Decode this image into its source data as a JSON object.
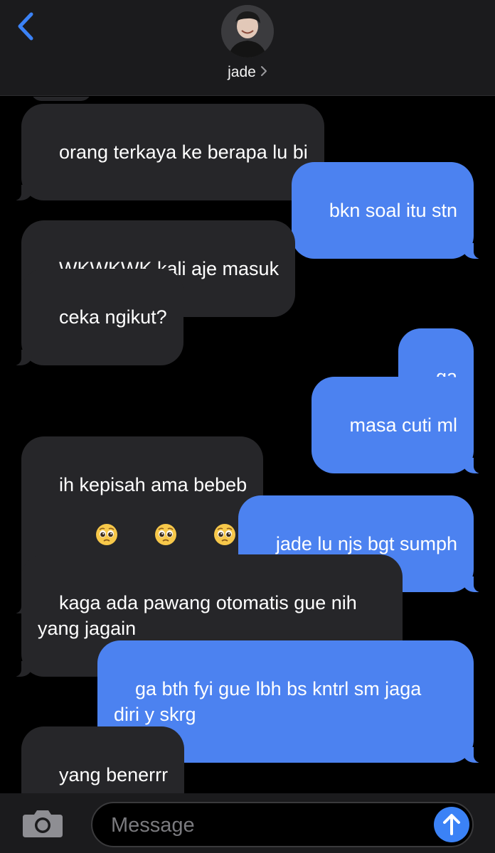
{
  "header": {
    "contact_name": "jade",
    "accent_color": "#3b82f6"
  },
  "messages": [
    {
      "direction": "incoming",
      "text": "orang terkaya ke berapa lu bi"
    },
    {
      "direction": "outgoing",
      "text": "bkn soal itu stn"
    },
    {
      "direction": "incoming",
      "text": "WKWKWK kali aje masuk"
    },
    {
      "direction": "incoming",
      "text": "ceka ngikut?"
    },
    {
      "direction": "outgoing",
      "text": "ga"
    },
    {
      "direction": "outgoing",
      "text": "masa cuti ml"
    },
    {
      "direction": "incoming",
      "text": "ih kepisah ama bebeb",
      "emoji": [
        "pleading-face",
        "pleading-face",
        "pleading-face"
      ]
    },
    {
      "direction": "outgoing",
      "text": "jade lu njs bgt sumph"
    },
    {
      "direction": "incoming",
      "text": "kaga ada pawang otomatis gue nih\nyang jagain"
    },
    {
      "direction": "outgoing",
      "text": "ga bth fyi gue lbh bs kntrl sm jaga\ndiri y skrg"
    },
    {
      "direction": "incoming",
      "text": "yang benerrr"
    }
  ],
  "composer": {
    "placeholder": "Message",
    "value": ""
  },
  "colors": {
    "incoming_bubble": "#262629",
    "outgoing_bubble": "#4c82f0",
    "background": "#000000"
  }
}
